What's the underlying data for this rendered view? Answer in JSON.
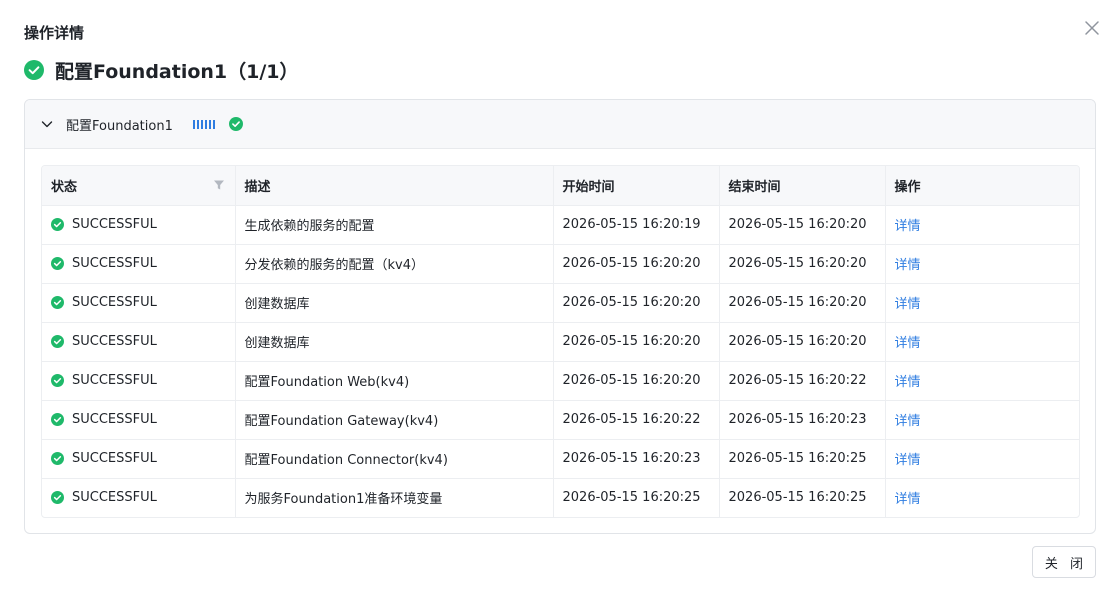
{
  "modal": {
    "title": "操作详情",
    "headline": "配置Foundation1（1/1）",
    "close_label": "关 闭"
  },
  "panel": {
    "title": "配置Foundation1"
  },
  "colors": {
    "success": "#1fb96a",
    "link": "#2f7de1",
    "progress": "#2f7de1"
  },
  "icons": {
    "close": "close-icon",
    "success": "check-circle-icon",
    "collapse": "chevron-down-icon",
    "filter": "filter-icon"
  },
  "table": {
    "columns": [
      "状态",
      "描述",
      "开始时间",
      "结束时间",
      "操作"
    ],
    "rows": [
      {
        "status": "SUCCESSFUL",
        "desc": "生成依赖的服务的配置",
        "start": "2026-05-15 16:20:19",
        "end": "2026-05-15 16:20:20",
        "action": "详情"
      },
      {
        "status": "SUCCESSFUL",
        "desc": "分发依赖的服务的配置（kv4）",
        "start": "2026-05-15 16:20:20",
        "end": "2026-05-15 16:20:20",
        "action": "详情"
      },
      {
        "status": "SUCCESSFUL",
        "desc": "创建数据库",
        "start": "2026-05-15 16:20:20",
        "end": "2026-05-15 16:20:20",
        "action": "详情"
      },
      {
        "status": "SUCCESSFUL",
        "desc": "创建数据库",
        "start": "2026-05-15 16:20:20",
        "end": "2026-05-15 16:20:20",
        "action": "详情"
      },
      {
        "status": "SUCCESSFUL",
        "desc": "配置Foundation Web(kv4)",
        "start": "2026-05-15 16:20:20",
        "end": "2026-05-15 16:20:22",
        "action": "详情"
      },
      {
        "status": "SUCCESSFUL",
        "desc": "配置Foundation Gateway(kv4)",
        "start": "2026-05-15 16:20:22",
        "end": "2026-05-15 16:20:23",
        "action": "详情"
      },
      {
        "status": "SUCCESSFUL",
        "desc": "配置Foundation Connector(kv4)",
        "start": "2026-05-15 16:20:23",
        "end": "2026-05-15 16:20:25",
        "action": "详情"
      },
      {
        "status": "SUCCESSFUL",
        "desc": "为服务Foundation1准备环境变量",
        "start": "2026-05-15 16:20:25",
        "end": "2026-05-15 16:20:25",
        "action": "详情"
      }
    ]
  }
}
